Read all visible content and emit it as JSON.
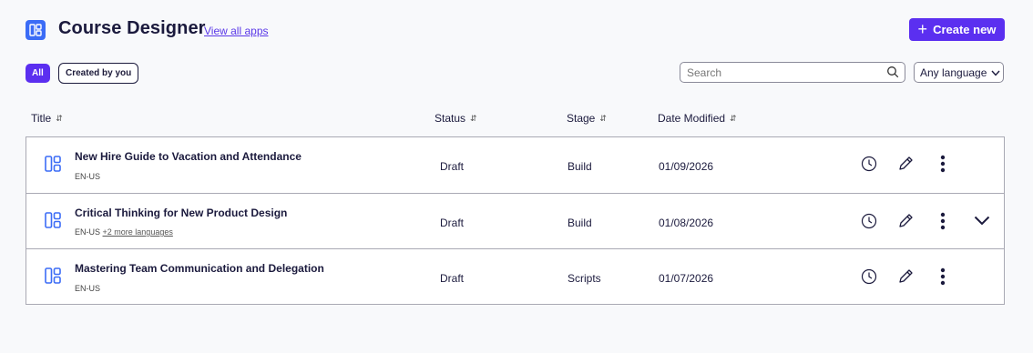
{
  "header": {
    "title": "Course Designer",
    "view_all": "View all apps",
    "create_label": "Create new",
    "create_icon": "plus-icon"
  },
  "filters": {
    "all": "All",
    "created_by_you": "Created by you"
  },
  "search": {
    "placeholder": "Search"
  },
  "language_select": {
    "value": "Any language"
  },
  "columns": {
    "title": "Title",
    "status": "Status",
    "stage": "Stage",
    "date": "Date Modified"
  },
  "rows": [
    {
      "title": "New Hire Guide to Vacation and Attendance",
      "lang": "EN-US",
      "more": "",
      "status": "Draft",
      "stage": "Build",
      "date": "01/09/2026"
    },
    {
      "title": "Critical Thinking for New Product Design",
      "lang": "EN-US",
      "more": "+2 more languages",
      "status": "Draft",
      "stage": "Build",
      "date": "01/08/2026"
    },
    {
      "title": "Mastering Team Communication and Delegation",
      "lang": "EN-US",
      "more": "",
      "status": "Draft",
      "stage": "Scripts",
      "date": "01/07/2026"
    }
  ],
  "colors": {
    "accent": "#5b2ff0",
    "app_icon": "#3b6cf6",
    "text": "#1b1a3d",
    "border": "#a9a9b4"
  }
}
